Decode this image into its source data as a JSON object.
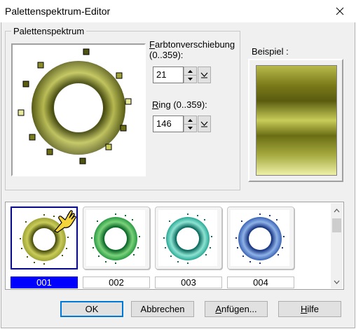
{
  "window": {
    "title": "Palettenspektrum-Editor",
    "close_glyph": "✕"
  },
  "group": {
    "title": "Palettenspektrum"
  },
  "hue_shift": {
    "label_line1": "Farbtonverschiebung",
    "label_mnemonic": "F",
    "label_rest": "arbtonverschiebung",
    "label_line2": "(0..359):",
    "value": "21"
  },
  "ring": {
    "label_mnemonic": "R",
    "label_rest": "ing (0..359):",
    "value": "146"
  },
  "example": {
    "label": "Beispiel :"
  },
  "palettes": [
    {
      "label": "001",
      "selected": true,
      "colors": [
        "#4f5410",
        "#c9cc58",
        "#a0a436"
      ]
    },
    {
      "label": "002",
      "selected": false,
      "colors": [
        "#0f6b2a",
        "#7ad27a",
        "#2a9a44"
      ]
    },
    {
      "label": "003",
      "selected": false,
      "colors": [
        "#0f6e62",
        "#8ee3d2",
        "#2aa896"
      ]
    },
    {
      "label": "004",
      "selected": false,
      "colors": [
        "#1c3a86",
        "#8fb2e8",
        "#3a64b4"
      ]
    }
  ],
  "buttons": {
    "ok": "OK",
    "cancel": "Abbrechen",
    "append_mnemonic": "A",
    "append_rest": "nfügen...",
    "help_mnemonic": "H",
    "help_rest": "ilfe"
  },
  "colors": {
    "selection": "#0000ff",
    "accent_focus": "#0078d7"
  },
  "icons": {
    "cursor": "pointing-hand-icon"
  }
}
